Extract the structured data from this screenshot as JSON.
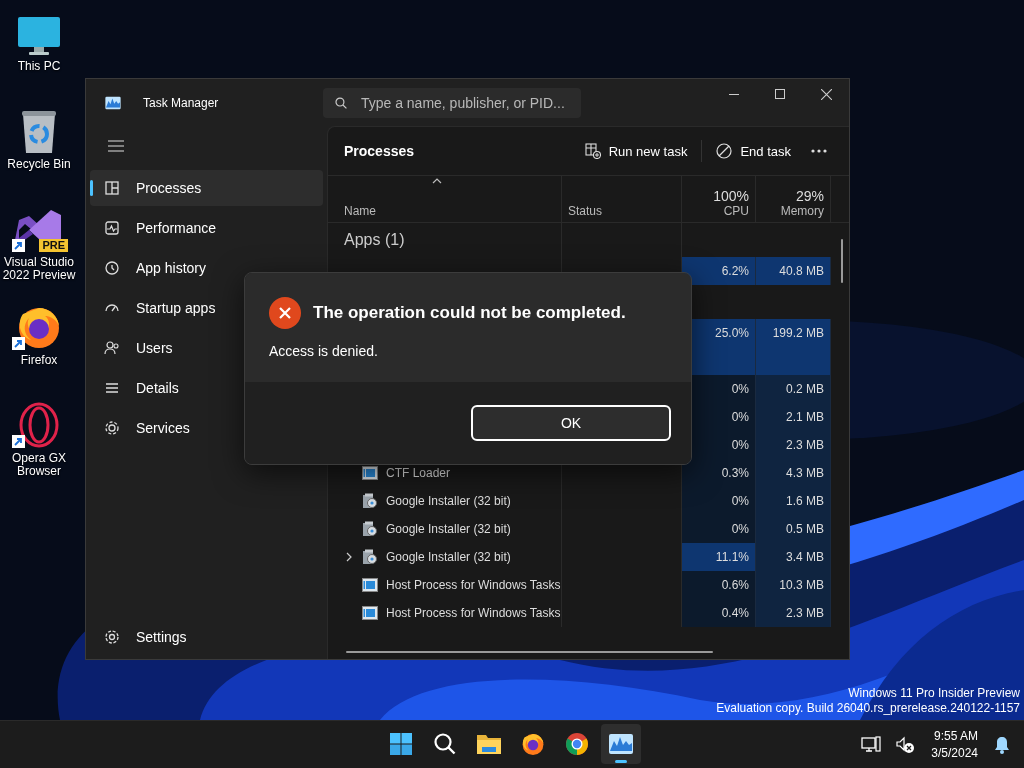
{
  "desktop_icons": [
    {
      "kind": "pc",
      "label": "This PC",
      "shortcut": false
    },
    {
      "kind": "bin",
      "label": "Recycle Bin",
      "shortcut": false
    },
    {
      "kind": "vs",
      "label": "Visual Studio 2022 Preview",
      "badge": "PRE",
      "shortcut": true
    },
    {
      "kind": "firefox",
      "label": "Firefox",
      "shortcut": true
    },
    {
      "kind": "opera",
      "label": "Opera GX Browser",
      "shortcut": true
    }
  ],
  "window": {
    "title": "Task Manager",
    "search": {
      "placeholder": "Type a name, publisher, or PID..."
    }
  },
  "sidebar": {
    "items": [
      {
        "kind": "processes",
        "label": "Processes",
        "selected": true
      },
      {
        "kind": "performance",
        "label": "Performance",
        "selected": false
      },
      {
        "kind": "history",
        "label": "App history",
        "selected": false
      },
      {
        "kind": "startup",
        "label": "Startup apps",
        "selected": false
      },
      {
        "kind": "users",
        "label": "Users",
        "selected": false
      },
      {
        "kind": "details",
        "label": "Details",
        "selected": false
      },
      {
        "kind": "services",
        "label": "Services",
        "selected": false
      }
    ],
    "settings": "Settings"
  },
  "toolbar": {
    "title": "Processes",
    "run_new_task": "Run new task",
    "end_task": "End task"
  },
  "table": {
    "columns": [
      {
        "kind": "name",
        "label": "Name"
      },
      {
        "kind": "status",
        "label": "Status"
      },
      {
        "kind": "usage",
        "usage": "100%",
        "label": "CPU"
      },
      {
        "kind": "usage",
        "usage": "29%",
        "label": "Memory"
      }
    ],
    "rows": [
      {
        "kind": "group",
        "label": "Apps (1)"
      },
      {
        "kind": "process",
        "cpu": "6.2%",
        "memory": "40.8 MB",
        "cpu_hot": true,
        "memory_hot": true
      },
      {
        "kind": "group"
      },
      {
        "kind": "process",
        "cpu": "25.0%",
        "memory": "199.2 MB",
        "cpu_hot": true,
        "memory_hot": true
      },
      {
        "kind": "process",
        "cpu_hot": true,
        "memory_hot": true
      },
      {
        "kind": "process",
        "cpu": "0%",
        "memory": "0.2 MB",
        "cpu_hot": false,
        "memory_hot": false
      },
      {
        "kind": "process",
        "cpu": "0%",
        "memory": "2.1 MB",
        "cpu_hot": false,
        "memory_hot": false
      },
      {
        "kind": "process",
        "cpu": "0%",
        "memory": "2.3 MB",
        "cpu_hot": false,
        "memory_hot": false
      },
      {
        "kind": "service",
        "name": "CTF Loader",
        "expandable": false,
        "cpu": "0.3%",
        "memory": "4.3 MB",
        "cpu_hot": false,
        "memory_hot": false
      },
      {
        "kind": "installer",
        "name": "Google Installer (32 bit)",
        "expandable": false,
        "cpu": "0%",
        "memory": "1.6 MB",
        "cpu_hot": false,
        "memory_hot": false
      },
      {
        "kind": "installer",
        "name": "Google Installer (32 bit)",
        "expandable": false,
        "cpu": "0%",
        "memory": "0.5 MB",
        "cpu_hot": false,
        "memory_hot": false
      },
      {
        "kind": "installer",
        "name": "Google Installer (32 bit)",
        "expandable": true,
        "cpu": "11.1%",
        "memory": "3.4 MB",
        "cpu_hot": true,
        "memory_hot": false
      },
      {
        "kind": "service",
        "name": "Host Process for Windows Tasks",
        "expandable": false,
        "cpu": "0.6%",
        "memory": "10.3 MB",
        "cpu_hot": false,
        "memory_hot": false
      },
      {
        "kind": "service",
        "name": "Host Process for Windows Tasks",
        "expandable": false,
        "cpu": "0.4%",
        "memory": "2.3 MB",
        "cpu_hot": false,
        "memory_hot": false
      }
    ]
  },
  "dialog": {
    "title": "The operation could not be completed.",
    "message": "Access is denied.",
    "button": "OK",
    "focused": true
  },
  "watermark": [
    "Windows 11 Pro Insider Preview",
    "Evaluation copy. Build 26040.rs_prerelease.240122-1157"
  ],
  "taskbar": {
    "apps": [
      {
        "kind": "start",
        "active": false
      },
      {
        "kind": "search",
        "active": false
      },
      {
        "kind": "explorer",
        "active": false
      },
      {
        "kind": "firefox",
        "active": false
      },
      {
        "kind": "chrome",
        "active": false
      },
      {
        "kind": "taskmanager",
        "active": true
      }
    ],
    "time": "9:55 AM",
    "date": "3/5/2024"
  }
}
